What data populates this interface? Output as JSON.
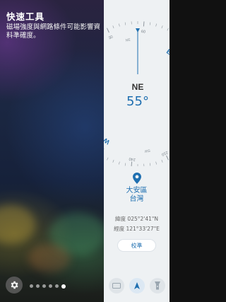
{
  "panel": {
    "title": "快速工具",
    "description": "磁場強度與網路條件可能影響資料準確度。"
  },
  "pager": {
    "page_count": 6,
    "active_index": 5
  },
  "compass": {
    "direction": "NE",
    "heading": "55°",
    "dial_labels": [
      "N",
      "E",
      "S",
      "W"
    ],
    "minor_labels": [
      "NE",
      "SE",
      "SW",
      "NW"
    ],
    "scale_numbers": [
      "300",
      "330",
      "0",
      "30",
      "60",
      "90",
      "120",
      "150",
      "180",
      "210",
      "240",
      "270"
    ]
  },
  "location": {
    "city": "大安區",
    "country": "台灣",
    "latitude": "緯度 025°2'41\"N",
    "longitude": "經度 121°33'27\"E"
  },
  "buttons": {
    "calibrate": "校準"
  },
  "colors": {
    "accent": "#1f6fb0",
    "north": "#e04040",
    "panel_bg": "#eef1f3"
  },
  "icons": [
    "gear-icon",
    "location-pin-icon",
    "rectangle-tool-icon",
    "compass-tool-icon",
    "flashlight-icon"
  ]
}
